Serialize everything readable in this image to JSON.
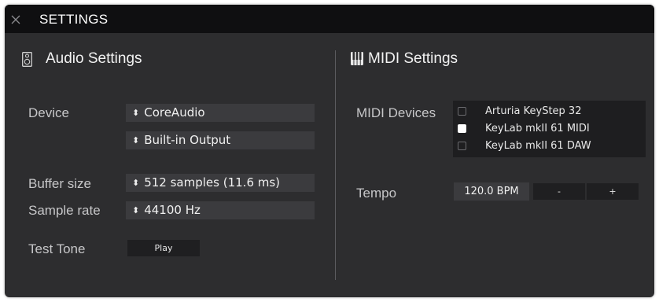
{
  "window": {
    "title": "SETTINGS"
  },
  "audio": {
    "heading": "Audio Settings",
    "device_label": "Device",
    "device_value": "CoreAudio",
    "output_value": "Built-in Output",
    "buffer_label": "Buffer size",
    "buffer_value": "512 samples (11.6 ms)",
    "samplerate_label": "Sample rate",
    "samplerate_value": "44100 Hz",
    "testtone_label": "Test Tone",
    "play_label": "Play"
  },
  "midi": {
    "heading": "MIDI Settings",
    "devices_label": "MIDI Devices",
    "devices": [
      {
        "name": "Arturia KeyStep 32",
        "checked": false
      },
      {
        "name": "KeyLab mkII 61 MIDI",
        "checked": true
      },
      {
        "name": "KeyLab mkII 61 DAW",
        "checked": false
      }
    ],
    "tempo_label": "Tempo",
    "tempo_value": "120.0 BPM",
    "minus_label": "-",
    "plus_label": "+"
  },
  "icons": {
    "close": "close-icon",
    "speaker": "speaker-icon",
    "piano": "piano-keys-icon",
    "select_arrows": "updown-arrows-icon"
  },
  "colors": {
    "panel": "#2d2d2f",
    "titlebar": "#0f0f11",
    "field": "#3b3b3e",
    "list": "#1e1e20",
    "text": "#f0f0f0"
  }
}
